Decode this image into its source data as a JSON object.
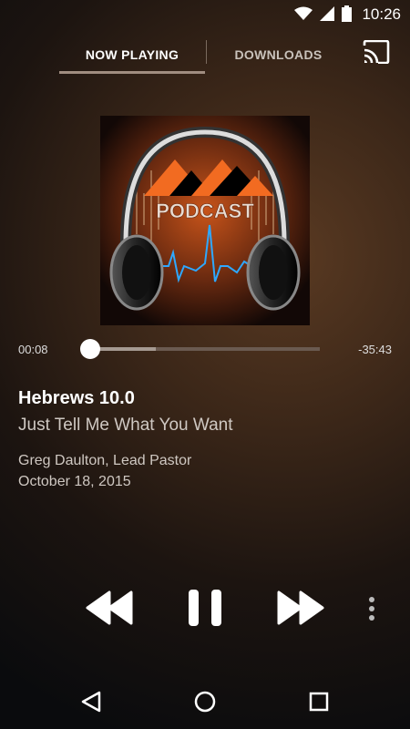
{
  "status": {
    "time": "10:26"
  },
  "tabs": [
    {
      "label": "NOW PLAYING"
    },
    {
      "label": "DOWNLOADS"
    }
  ],
  "artwork": {
    "label": "PODCAST"
  },
  "player": {
    "elapsed": "00:08",
    "remaining": "-35:43",
    "progress": 0.004,
    "buffered": 0.29
  },
  "episode": {
    "title": "Hebrews 10.0",
    "subtitle": "Just Tell Me What You Want",
    "author": "Greg Daulton, Lead Pastor",
    "date": "October 18, 2015"
  },
  "colors": {
    "accent": "#a08d80",
    "artwork_orange": "#f26b21"
  },
  "icons": {
    "status": [
      "wifi-icon",
      "signal-icon",
      "battery-icon"
    ],
    "controls": [
      "rewind-icon",
      "pause-icon",
      "fast-forward-icon",
      "more-vert-icon"
    ],
    "nav": [
      "back-icon",
      "home-icon",
      "recents-icon"
    ]
  }
}
